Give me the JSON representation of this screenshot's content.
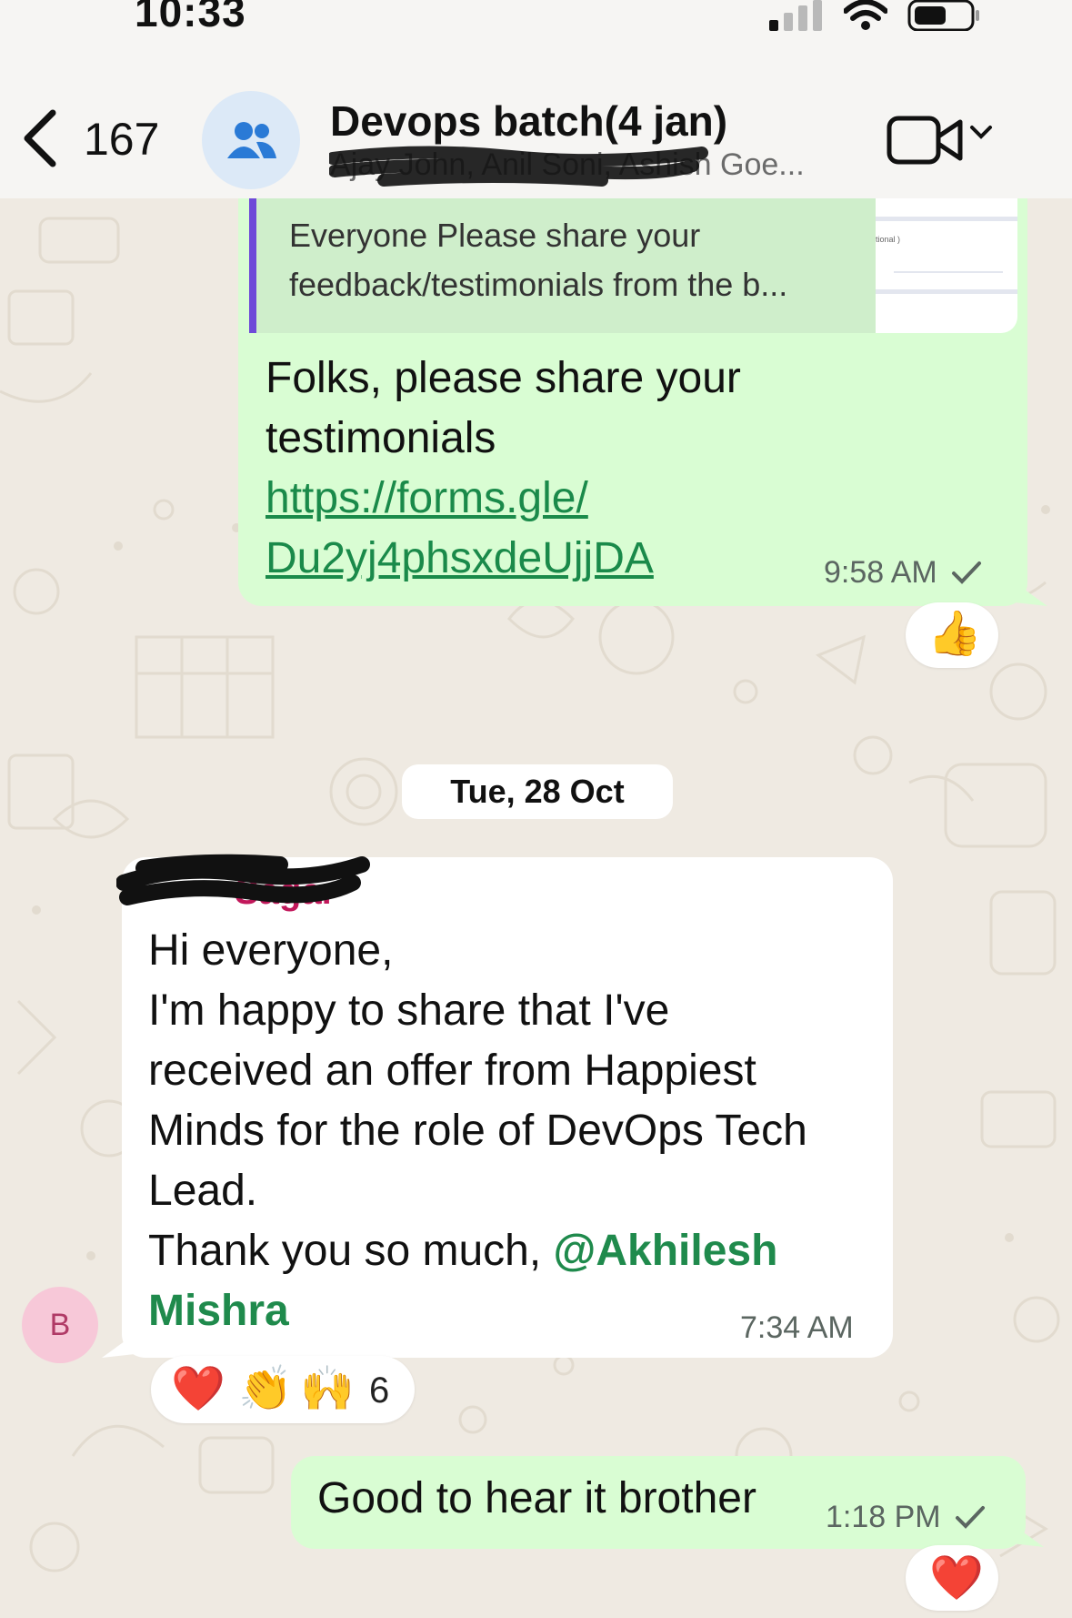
{
  "status_bar": {
    "time": "10:33"
  },
  "header": {
    "back_count": "167",
    "group_name": "Devops batch(4 jan)",
    "members_preview": "Ajay John, Anil Soni, Ashish Goe..."
  },
  "messages": {
    "m1": {
      "quote_text": "Everyone Please share your feedback/testimonials from the b...",
      "quote_thumb_label": "tional )",
      "text_line1": "Folks, please share your",
      "text_line2": "testimonials",
      "link_line1": "https://forms.gle/",
      "link_line2": "Du2yj4phsxdeUjjDA",
      "time": "9:58 AM",
      "reaction": "👍"
    },
    "date_divider": "Tue, 28 Oct",
    "m2": {
      "sender": "Sagar",
      "lines": [
        "Hi everyone,",
        "I'm happy to share that I've",
        "received an offer from Happiest",
        "Minds for the role of DevOps Tech",
        "Lead.",
        "Thank you so much, "
      ],
      "mention_line1": "@Akhilesh",
      "mention_line2": "Mishra",
      "time": "7:34 AM",
      "avatar_initial": "B",
      "reactions": {
        "r1": "❤️",
        "r2": "👏",
        "r3": "🙌",
        "count": "6"
      }
    },
    "m3": {
      "text": "Good to hear it brother",
      "time": "1:18 PM",
      "reaction": "❤️"
    }
  },
  "colors": {
    "outgoing_bubble": "#d9fdd3",
    "incoming_bubble": "#ffffff",
    "link": "#1a8a4a",
    "sender_name": "#c2185b",
    "mention": "#1f8a4c",
    "quote_bar": "#6e4ad8"
  },
  "icons": {
    "back": "chevron-left-icon",
    "group_avatar": "group-people-icon",
    "video": "video-camera-icon",
    "read_tick": "checkmark-icon"
  }
}
